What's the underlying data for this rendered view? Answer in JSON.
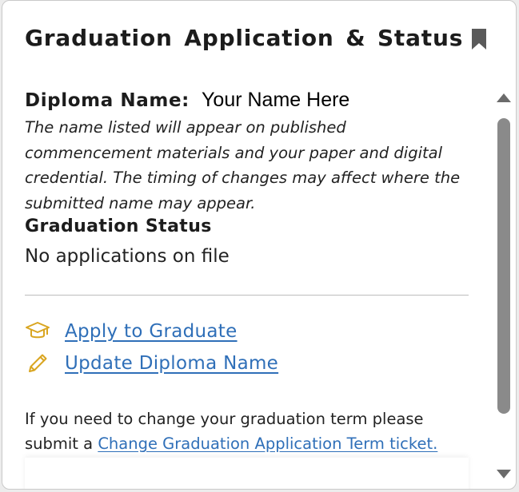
{
  "card": {
    "title": "Graduation Application & Status",
    "bookmark_icon": "bookmark-icon"
  },
  "diploma": {
    "label": "Diploma Name:",
    "value": "Your Name Here",
    "note": "The name listed will appear on published commencement materials and your paper and digital credential. The timing of changes may affect where the submitted name may appear."
  },
  "status": {
    "heading": "Graduation Status",
    "value": "No applications on file"
  },
  "links": [
    {
      "label": "Apply to Graduate",
      "icon": "graduation-cap-icon"
    },
    {
      "label": "Update Diploma Name",
      "icon": "pencil-icon"
    }
  ],
  "footer": {
    "text": "If you need to change your graduation term please submit a",
    "link_label": "Change Graduation Application Term ticket."
  },
  "colors": {
    "link": "#2f6fb8",
    "icon_gold": "#d9a520",
    "scroll_thumb": "#8a8a8a"
  }
}
